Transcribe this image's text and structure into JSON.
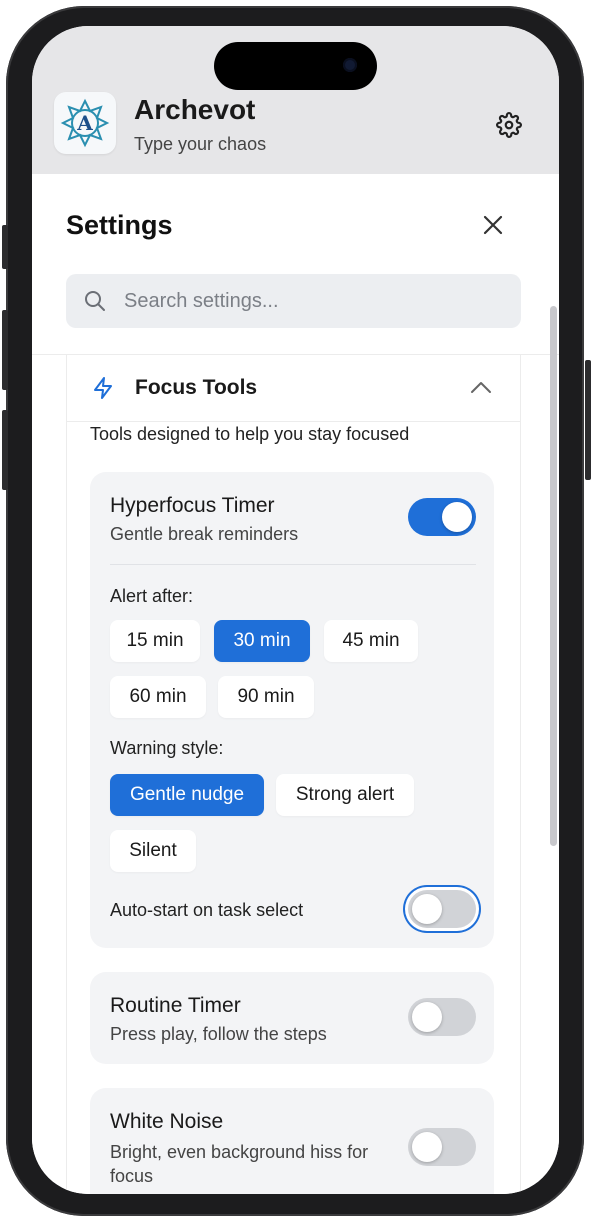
{
  "app": {
    "title": "Archevot",
    "tagline": "Type your chaos",
    "logo_letter": "A",
    "settings_icon": "gear-icon"
  },
  "settings": {
    "title": "Settings",
    "close_icon": "close-icon",
    "search_placeholder": "Search settings...",
    "search_value": ""
  },
  "section": {
    "icon": "bolt-icon",
    "title": "Focus Tools",
    "expanded": true,
    "description": "Tools designed to help you stay focused"
  },
  "hyperfocus": {
    "title": "Hyperfocus Timer",
    "subtitle": "Gentle break reminders",
    "enabled": true,
    "alert_label": "Alert after:",
    "alert_options": [
      "15 min",
      "30 min",
      "45 min",
      "60 min",
      "90 min"
    ],
    "alert_selected": "30 min",
    "warning_label": "Warning style:",
    "warning_options": [
      "Gentle nudge",
      "Strong alert",
      "Silent"
    ],
    "warning_selected": "Gentle nudge",
    "autostart_label": "Auto-start on task select",
    "autostart_enabled": false
  },
  "routine": {
    "title": "Routine Timer",
    "subtitle": "Press play, follow the steps",
    "enabled": false
  },
  "noise": {
    "title": "White Noise",
    "subtitle": "Bright, even background hiss for focus",
    "enabled": false
  },
  "colors": {
    "accent": "#1f6fd8",
    "header_bg": "#e6e6e8",
    "card_bg": "#f3f4f6"
  }
}
